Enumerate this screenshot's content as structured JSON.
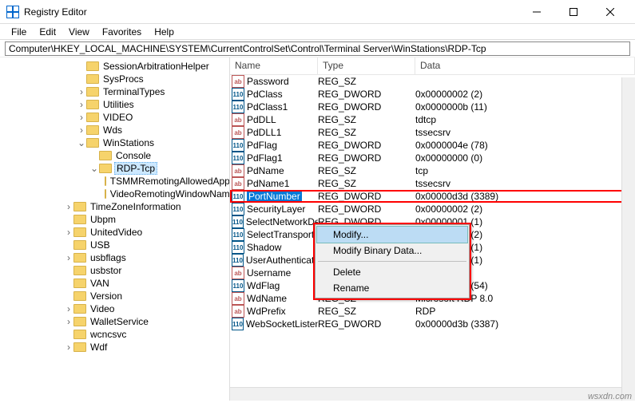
{
  "window": {
    "title": "Registry Editor"
  },
  "menu": {
    "file": "File",
    "edit": "Edit",
    "view": "View",
    "favorites": "Favorites",
    "help": "Help"
  },
  "address": {
    "path": "Computer\\HKEY_LOCAL_MACHINE\\SYSTEM\\CurrentControlSet\\Control\\Terminal Server\\WinStations\\RDP-Tcp"
  },
  "tree": {
    "items": [
      {
        "depth": 6,
        "arrow": "none",
        "label": "SessionArbitrationHelper"
      },
      {
        "depth": 6,
        "arrow": "none",
        "label": "SysProcs"
      },
      {
        "depth": 6,
        "arrow": "closed",
        "label": "TerminalTypes"
      },
      {
        "depth": 6,
        "arrow": "closed",
        "label": "Utilities"
      },
      {
        "depth": 6,
        "arrow": "closed",
        "label": "VIDEO"
      },
      {
        "depth": 6,
        "arrow": "closed",
        "label": "Wds"
      },
      {
        "depth": 6,
        "arrow": "open",
        "label": "WinStations"
      },
      {
        "depth": 7,
        "arrow": "none",
        "label": "Console"
      },
      {
        "depth": 7,
        "arrow": "open",
        "label": "RDP-Tcp",
        "selected": true
      },
      {
        "depth": 8,
        "arrow": "none",
        "label": "TSMMRemotingAllowedApps"
      },
      {
        "depth": 8,
        "arrow": "none",
        "label": "VideoRemotingWindowNames"
      },
      {
        "depth": 5,
        "arrow": "closed",
        "label": "TimeZoneInformation"
      },
      {
        "depth": 5,
        "arrow": "none",
        "label": "Ubpm"
      },
      {
        "depth": 5,
        "arrow": "closed",
        "label": "UnitedVideo"
      },
      {
        "depth": 5,
        "arrow": "none",
        "label": "USB"
      },
      {
        "depth": 5,
        "arrow": "closed",
        "label": "usbflags"
      },
      {
        "depth": 5,
        "arrow": "none",
        "label": "usbstor"
      },
      {
        "depth": 5,
        "arrow": "none",
        "label": "VAN"
      },
      {
        "depth": 5,
        "arrow": "none",
        "label": "Version"
      },
      {
        "depth": 5,
        "arrow": "closed",
        "label": "Video"
      },
      {
        "depth": 5,
        "arrow": "closed",
        "label": "WalletService"
      },
      {
        "depth": 5,
        "arrow": "none",
        "label": "wcncsvc"
      },
      {
        "depth": 5,
        "arrow": "closed",
        "label": "Wdf"
      }
    ]
  },
  "list": {
    "header": {
      "name": "Name",
      "type": "Type",
      "data": "Data"
    },
    "rows": [
      {
        "icon": "sz",
        "name": "Password",
        "type": "REG_SZ",
        "data": ""
      },
      {
        "icon": "dw",
        "name": "PdClass",
        "type": "REG_DWORD",
        "data": "0x00000002 (2)"
      },
      {
        "icon": "dw",
        "name": "PdClass1",
        "type": "REG_DWORD",
        "data": "0x0000000b (11)"
      },
      {
        "icon": "sz",
        "name": "PdDLL",
        "type": "REG_SZ",
        "data": "tdtcp"
      },
      {
        "icon": "sz",
        "name": "PdDLL1",
        "type": "REG_SZ",
        "data": "tssecsrv"
      },
      {
        "icon": "dw",
        "name": "PdFlag",
        "type": "REG_DWORD",
        "data": "0x0000004e (78)"
      },
      {
        "icon": "dw",
        "name": "PdFlag1",
        "type": "REG_DWORD",
        "data": "0x00000000 (0)"
      },
      {
        "icon": "sz",
        "name": "PdName",
        "type": "REG_SZ",
        "data": "tcp"
      },
      {
        "icon": "sz",
        "name": "PdName1",
        "type": "REG_SZ",
        "data": "tssecsrv"
      },
      {
        "icon": "dw",
        "name": "PortNumber",
        "type": "REG_DWORD",
        "data": "0x00000d3d (3389)",
        "selected": true,
        "hl": true
      },
      {
        "icon": "dw",
        "name": "SecurityLayer",
        "type": "REG_DWORD",
        "data": "0x00000002 (2)"
      },
      {
        "icon": "dw",
        "name": "SelectNetworkDetect",
        "type": "REG_DWORD",
        "data": "0x00000001 (1)"
      },
      {
        "icon": "dw",
        "name": "SelectTransport",
        "type": "REG_DWORD",
        "data": "0x00000002 (2)"
      },
      {
        "icon": "dw",
        "name": "Shadow",
        "type": "REG_DWORD",
        "data": "0x00000001 (1)"
      },
      {
        "icon": "dw",
        "name": "UserAuthentication",
        "type": "REG_DWORD",
        "data": "0x00000001 (1)"
      },
      {
        "icon": "sz",
        "name": "Username",
        "type": "REG_SZ",
        "data": ""
      },
      {
        "icon": "dw",
        "name": "WdFlag",
        "type": "REG_DWORD",
        "data": "0x00000036 (54)"
      },
      {
        "icon": "sz",
        "name": "WdName",
        "type": "REG_SZ",
        "data": "Microsoft RDP 8.0"
      },
      {
        "icon": "sz",
        "name": "WdPrefix",
        "type": "REG_SZ",
        "data": "RDP"
      },
      {
        "icon": "dw",
        "name": "WebSocketListenPort",
        "type": "REG_DWORD",
        "data": "0x00000d3b (3387)"
      }
    ]
  },
  "context": {
    "modify": "Modify...",
    "modify_binary": "Modify Binary Data...",
    "delete": "Delete",
    "rename": "Rename"
  },
  "watermark": "wsxdn.com"
}
